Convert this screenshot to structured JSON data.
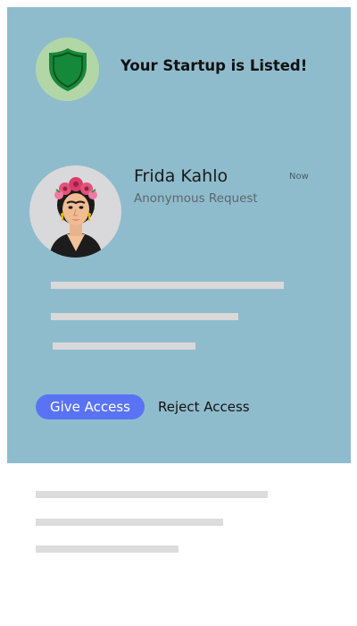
{
  "card": {
    "title": "Your Startup is Listed!",
    "badge_icon": "shield-icon",
    "background": "#8fbccc"
  },
  "request": {
    "name": "Frida Kahlo",
    "subtitle": "Anonymous Request",
    "time": "Now",
    "avatar_icon": "avatar-illustration"
  },
  "actions": {
    "give_label": "Give Access",
    "reject_label": "Reject Access",
    "accent": "#5a73f4"
  }
}
